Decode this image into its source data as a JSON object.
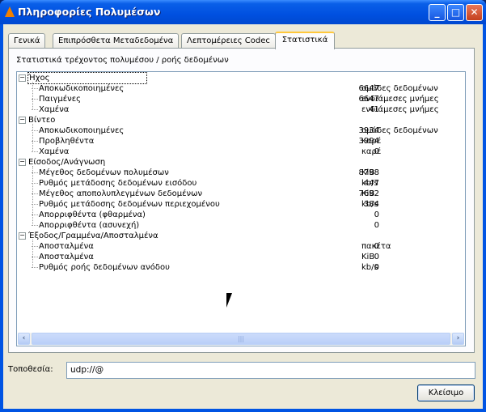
{
  "window": {
    "title": "Πληροφορίες Πολυμέσων"
  },
  "tabs": [
    {
      "label": "Γενικά"
    },
    {
      "label": "Επιπρόσθετα Μεταδεδομένα"
    },
    {
      "label": "Λεπτομέρειες Codec"
    },
    {
      "label": "Στατιστικά",
      "active": true
    }
  ],
  "panel": {
    "title": "Στατιστικά τρέχοντος πολυμέσου / ροής δεδομένων"
  },
  "tree": [
    {
      "label": "Ήχος",
      "items": [
        {
          "label": "Αποκωδικοποιημένες",
          "value": "6647",
          "unit": "ομάδες δεδομένων"
        },
        {
          "label": "Παιγμένες",
          "value": "6647",
          "unit": "ενδιάμεσες μνήμες"
        },
        {
          "label": "Χαμένα",
          "value": "41",
          "unit": "ενδιάμεσες μνήμες"
        }
      ]
    },
    {
      "label": "Βίντεο",
      "items": [
        {
          "label": "Αποκωδικοποιημένες",
          "value": "3934",
          "unit": "ομάδες δεδομένων"
        },
        {
          "label": "Προβληθέντα",
          "value": "3994",
          "unit": "καρέ"
        },
        {
          "label": "Χαμένα",
          "value": "0",
          "unit": "καρέ"
        }
      ]
    },
    {
      "label": "Είσοδος/Ανάγνωση",
      "items": [
        {
          "label": "Μέγεθος δεδομένων πολυμέσων",
          "value": "8798",
          "unit": "KiB"
        },
        {
          "label": "Ρυθμός μετάδοσης δεδομένων εισόδου",
          "value": "447",
          "unit": "kb/s"
        },
        {
          "label": "Μέγεθος αποπολυπλεγμένων δεδομένων",
          "value": "7692",
          "unit": "KiB"
        },
        {
          "label": "Ρυθμός μετάδοσης δεδομένων περιεχομένου",
          "value": "384",
          "unit": "kb/s"
        },
        {
          "label": "Απορριφθέντα (φθαρμένα)",
          "value": "0",
          "unit": ""
        },
        {
          "label": "Απορριφθέντα (ασυνεχή)",
          "value": "0",
          "unit": ""
        }
      ]
    },
    {
      "label": "Έξοδος/Γραμμένα/Αποσταλμένα",
      "items": [
        {
          "label": "Αποσταλμένα",
          "value": "0",
          "unit": "πακέτα"
        },
        {
          "label": "Αποσταλμένα",
          "value": "0",
          "unit": "KiB"
        },
        {
          "label": "Ρυθμός ροής δεδομένων ανόδου",
          "value": "0",
          "unit": "kb/s"
        }
      ]
    }
  ],
  "location": {
    "label": "Τοποθεσία:",
    "value": "udp://@"
  },
  "buttons": {
    "close": "Κλείσιμο"
  }
}
